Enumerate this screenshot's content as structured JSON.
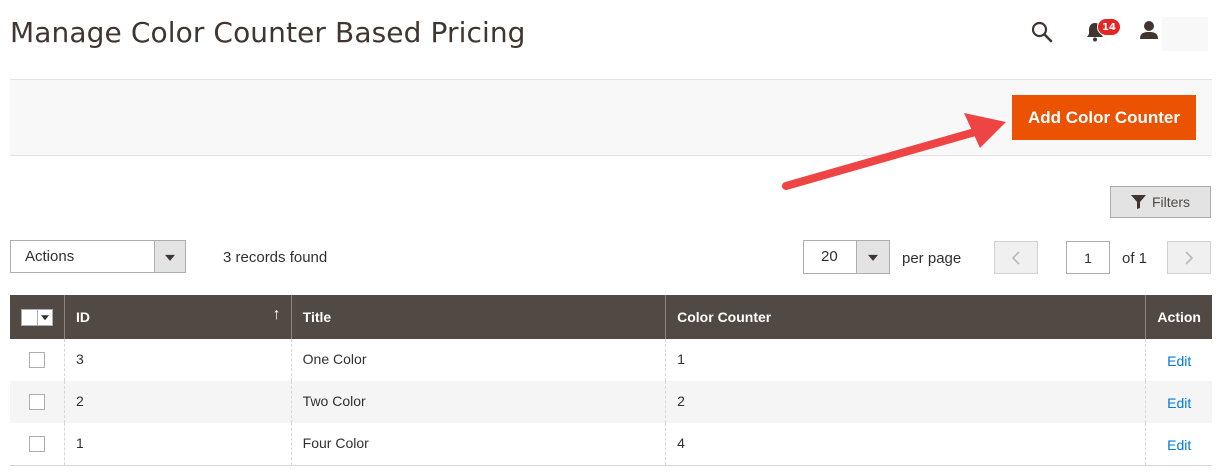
{
  "header": {
    "title": "Manage Color Counter Based Pricing",
    "notifications_count": "14"
  },
  "actions": {
    "add_button_label": "Add Color Counter"
  },
  "toolbar": {
    "filters_label": "Filters",
    "actions_select_label": "Actions",
    "records_found": "3 records found",
    "per_page_value": "20",
    "per_page_label": "per page",
    "current_page": "1",
    "page_of": "of 1"
  },
  "grid": {
    "columns": {
      "id": "ID",
      "title": "Title",
      "color_counter": "Color Counter",
      "action": "Action"
    },
    "sort_indicator": "↑",
    "rows": [
      {
        "id": "3",
        "title": "One Color",
        "color_counter": "1",
        "action": "Edit"
      },
      {
        "id": "2",
        "title": "Two Color",
        "color_counter": "2",
        "action": "Edit"
      },
      {
        "id": "1",
        "title": "Four Color",
        "color_counter": "4",
        "action": "Edit"
      }
    ]
  },
  "colors": {
    "primary_button": "#eb5202",
    "grid_header": "#514943",
    "badge": "#e22626",
    "link": "#007bdb",
    "annotation_arrow": "#ef4444"
  },
  "icons": {
    "search": "search-icon",
    "notifications": "bell-icon",
    "user": "user-icon",
    "filter": "funnel-icon",
    "prev": "chevron-left-icon",
    "next": "chevron-right-icon"
  }
}
